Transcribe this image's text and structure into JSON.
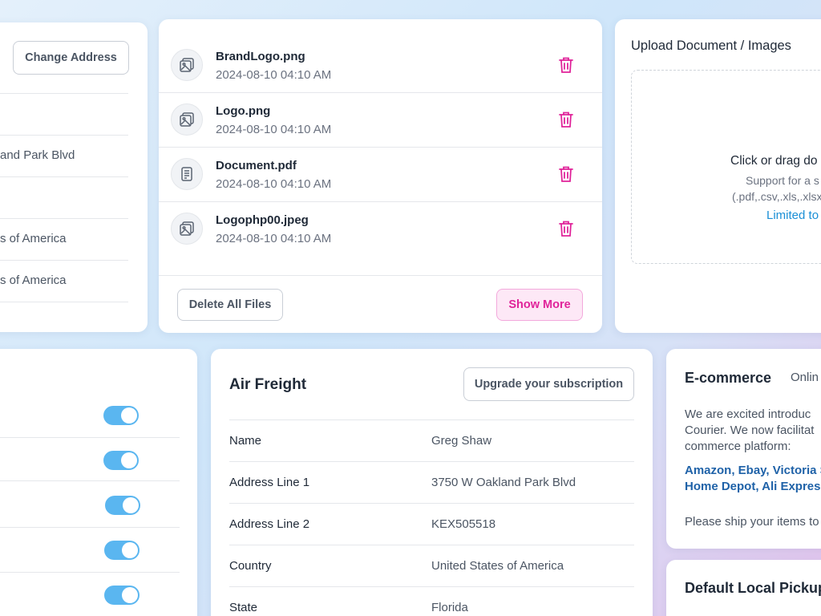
{
  "address_card": {
    "change_address_label": "Change Address",
    "rows": [
      "",
      "and Park Blvd",
      "",
      "s of America",
      "s of America"
    ]
  },
  "files_card": {
    "files": [
      {
        "name": "BrandLogo.png",
        "date": "2024-08-10 04:10 AM",
        "icon": "image-icon"
      },
      {
        "name": "Logo.png",
        "date": "2024-08-10 04:10 AM",
        "icon": "image-icon"
      },
      {
        "name": "Document.pdf",
        "date": "2024-08-10 04:10 AM",
        "icon": "document-icon"
      },
      {
        "name": "Logophp00.jpeg",
        "date": "2024-08-10 04:10 AM",
        "icon": "image-icon"
      }
    ],
    "delete_all_label": "Delete All Files",
    "show_more_label": "Show More"
  },
  "upload_card": {
    "title": "Upload Document / Images",
    "drop_title": "Click or drag do",
    "support_line1": "Support for a s",
    "support_line2": "(.pdf,.csv,.xls,.xlsx",
    "limit_text": "Limited to"
  },
  "toggles_card": {
    "toggles": [
      true,
      true,
      true,
      true,
      true
    ]
  },
  "freight_card": {
    "title": "Air Freight",
    "upgrade_label": "Upgrade your subscription",
    "rows": [
      {
        "label": "Name",
        "value": "Greg Shaw"
      },
      {
        "label": "Address Line 1",
        "value": "3750 W Oakland Park Blvd"
      },
      {
        "label": "Address Line 2",
        "value": "KEX505518"
      },
      {
        "label": "Country",
        "value": "United States of America"
      },
      {
        "label": "State",
        "value": "Florida"
      }
    ]
  },
  "ecommerce_card": {
    "title": "E-commerce",
    "tag": "Onlin",
    "text_lines": [
      "We are excited introduc",
      "Courier. We now facilitat",
      "commerce platform:"
    ],
    "link_lines": [
      "Amazon, Ebay, Victoria S",
      "Home Depot, Ali Express"
    ],
    "footer_text": "Please ship your items to"
  },
  "pickup_card": {
    "title": "Default Local Pickup"
  },
  "colors": {
    "accent_pink": "#e0249a",
    "toggle_blue": "#5ab6f0",
    "link_blue": "#1f62a8"
  }
}
